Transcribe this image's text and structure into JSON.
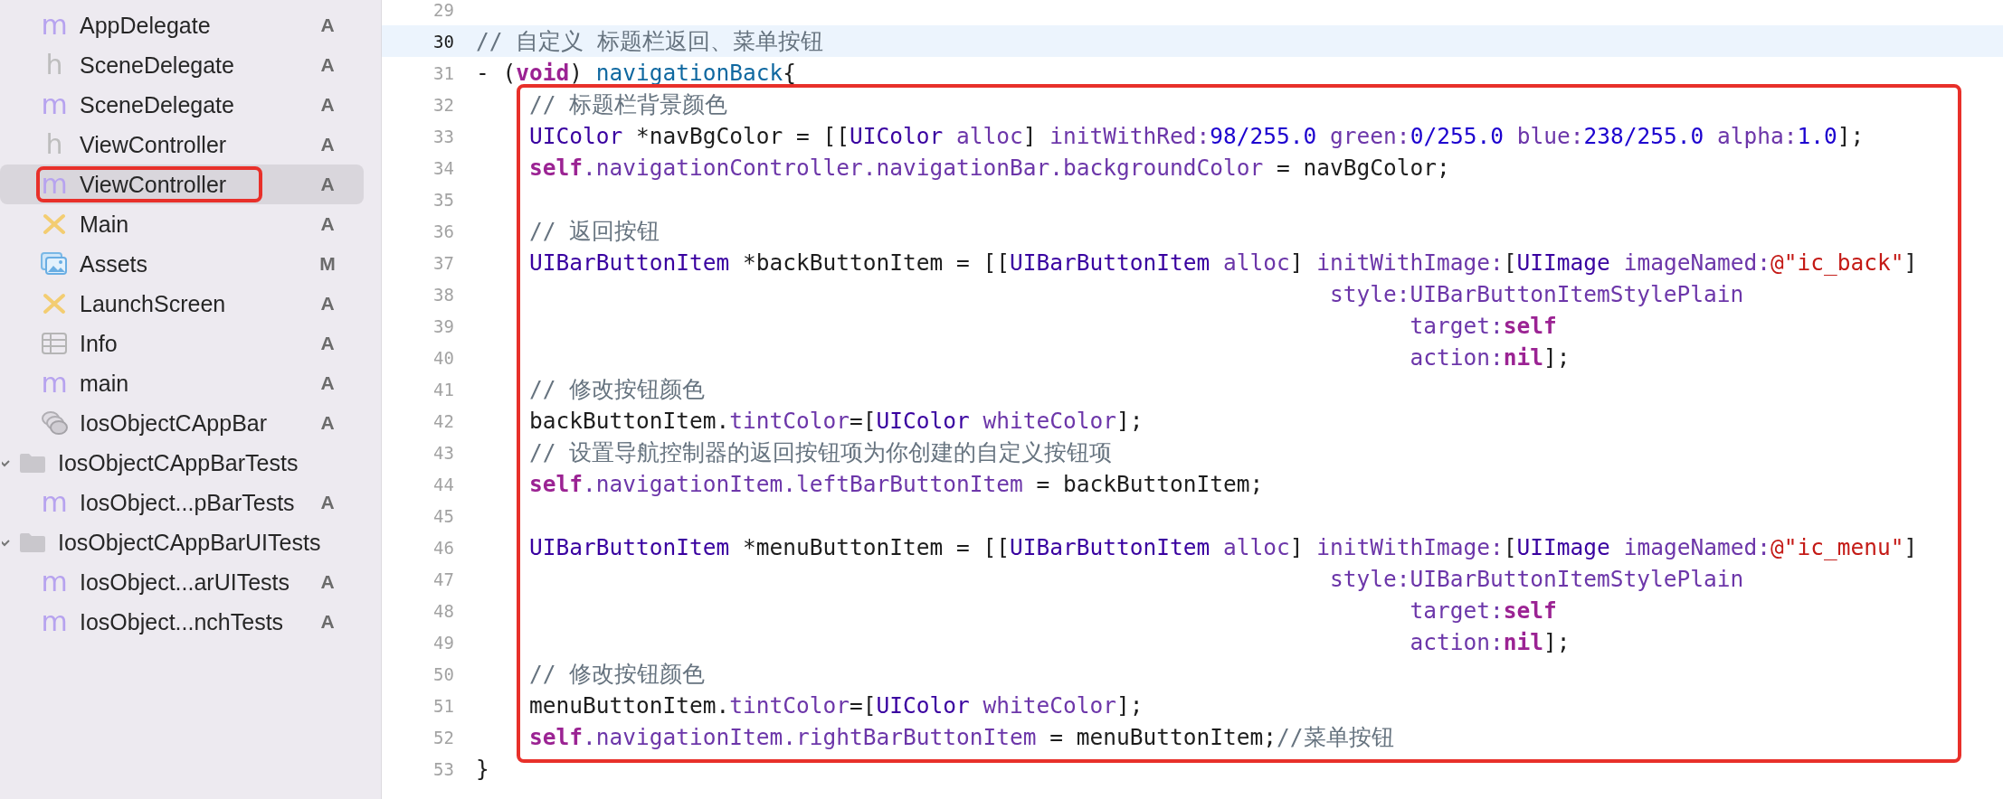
{
  "sidebar": {
    "items": [
      {
        "kind": "source",
        "glyph": "m",
        "name": "AppDelegate",
        "badge": "A",
        "selected": false,
        "outlined": false
      },
      {
        "kind": "header",
        "glyph": "h",
        "name": "SceneDelegate",
        "badge": "A",
        "selected": false,
        "outlined": false
      },
      {
        "kind": "source",
        "glyph": "m",
        "name": "SceneDelegate",
        "badge": "A",
        "selected": false,
        "outlined": false
      },
      {
        "kind": "header",
        "glyph": "h",
        "name": "ViewController",
        "badge": "A",
        "selected": false,
        "outlined": false
      },
      {
        "kind": "source",
        "glyph": "m",
        "name": "ViewController",
        "badge": "A",
        "selected": true,
        "outlined": true
      },
      {
        "kind": "storyboard",
        "name": "Main",
        "badge": "A",
        "selected": false,
        "outlined": false
      },
      {
        "kind": "assets",
        "name": "Assets",
        "badge": "M",
        "selected": false,
        "outlined": false
      },
      {
        "kind": "storyboard",
        "name": "LaunchScreen",
        "badge": "A",
        "selected": false,
        "outlined": false
      },
      {
        "kind": "plist",
        "name": "Info",
        "badge": "A",
        "selected": false,
        "outlined": false
      },
      {
        "kind": "source",
        "glyph": "m",
        "name": "main",
        "badge": "A",
        "selected": false,
        "outlined": false
      },
      {
        "kind": "app",
        "name": "IosObjectCAppBar",
        "badge": "A",
        "selected": false,
        "outlined": false
      },
      {
        "kind": "folder",
        "name": "IosObjectCAppBarTests",
        "expanded": true,
        "selected": false,
        "outlined": false,
        "children": [
          {
            "kind": "source",
            "glyph": "m",
            "name": "IosObject...pBarTests",
            "badge": "A",
            "selected": false,
            "outlined": false
          }
        ]
      },
      {
        "kind": "folder",
        "name": "IosObjectCAppBarUITests",
        "expanded": true,
        "selected": false,
        "outlined": false,
        "children": [
          {
            "kind": "source",
            "glyph": "m",
            "name": "IosObject...arUITests",
            "badge": "A",
            "selected": false,
            "outlined": false
          },
          {
            "kind": "source",
            "glyph": "m",
            "name": "IosObject...nchTests",
            "badge": "A",
            "selected": false,
            "outlined": false
          }
        ]
      }
    ]
  },
  "editor": {
    "sections": [
      {
        "boxed": false,
        "lines": [
          {
            "number": "29",
            "current": false
          },
          {
            "number": "30",
            "current": true,
            "tokens": [
              {
                "kind": "comment",
                "text": "// 自定义 标题栏返回、菜单按钮"
              }
            ]
          },
          {
            "number": "31",
            "current": false,
            "tokens": [
              {
                "kind": "plain",
                "text": "- ("
              },
              {
                "kind": "keyword",
                "text": "void"
              },
              {
                "kind": "plain",
                "text": ") "
              },
              {
                "kind": "decl",
                "text": "navigationBack"
              },
              {
                "kind": "plain",
                "text": "{"
              }
            ]
          }
        ]
      },
      {
        "boxed": true,
        "lines": [
          {
            "number": "32",
            "current": false,
            "tokens": [
              {
                "kind": "comment",
                "text": "    // 标题栏背景颜色"
              }
            ]
          },
          {
            "number": "33",
            "current": false,
            "tokens": [
              {
                "kind": "type",
                "text": "    UIColor"
              },
              {
                "kind": "plain",
                "text": " *navBgColor = [["
              },
              {
                "kind": "type",
                "text": "UIColor"
              },
              {
                "kind": "method",
                "text": " alloc"
              },
              {
                "kind": "plain",
                "text": "] "
              },
              {
                "kind": "method",
                "text": "initWithRed:"
              },
              {
                "kind": "number",
                "text": "98/255.0"
              },
              {
                "kind": "method",
                "text": " green:"
              },
              {
                "kind": "number",
                "text": "0/255.0"
              },
              {
                "kind": "method",
                "text": " blue:"
              },
              {
                "kind": "number",
                "text": "238/255.0"
              },
              {
                "kind": "method",
                "text": " alpha:"
              },
              {
                "kind": "number",
                "text": "1.0"
              },
              {
                "kind": "plain",
                "text": "];"
              }
            ]
          },
          {
            "number": "34",
            "current": false,
            "tokens": [
              {
                "kind": "keyword",
                "text": "    self"
              },
              {
                "kind": "method",
                "text": ".navigationController.navigationBar.backgroundColor"
              },
              {
                "kind": "plain",
                "text": " = navBgColor;"
              }
            ]
          },
          {
            "number": "35",
            "current": false
          },
          {
            "number": "36",
            "current": false,
            "tokens": [
              {
                "kind": "comment",
                "text": "    // 返回按钮"
              }
            ]
          },
          {
            "number": "37",
            "current": false,
            "tokens": [
              {
                "kind": "type",
                "text": "    UIBarButtonItem"
              },
              {
                "kind": "plain",
                "text": " *backButtonItem = [["
              },
              {
                "kind": "type",
                "text": "UIBarButtonItem"
              },
              {
                "kind": "method",
                "text": " alloc"
              },
              {
                "kind": "plain",
                "text": "] "
              },
              {
                "kind": "method",
                "text": "initWithImage:"
              },
              {
                "kind": "plain",
                "text": "["
              },
              {
                "kind": "type",
                "text": "UIImage"
              },
              {
                "kind": "method",
                "text": " imageNamed:"
              },
              {
                "kind": "string",
                "text": "@\"ic_back\""
              },
              {
                "kind": "plain",
                "text": "]"
              }
            ]
          },
          {
            "number": "38",
            "current": false,
            "tokens": [
              {
                "kind": "method",
                "text": "                                                                style:UIBarButtonItemStylePlain"
              }
            ]
          },
          {
            "number": "39",
            "current": false,
            "tokens": [
              {
                "kind": "method",
                "text": "                                                                      target:"
              },
              {
                "kind": "keyword",
                "text": "self"
              }
            ]
          },
          {
            "number": "40",
            "current": false,
            "tokens": [
              {
                "kind": "method",
                "text": "                                                                      action:"
              },
              {
                "kind": "keyword",
                "text": "nil"
              },
              {
                "kind": "plain",
                "text": "];"
              }
            ]
          },
          {
            "number": "41",
            "current": false,
            "tokens": [
              {
                "kind": "comment",
                "text": "    // 修改按钮颜色"
              }
            ]
          },
          {
            "number": "42",
            "current": false,
            "tokens": [
              {
                "kind": "plain",
                "text": "    backButtonItem."
              },
              {
                "kind": "method",
                "text": "tintColor"
              },
              {
                "kind": "plain",
                "text": "=["
              },
              {
                "kind": "type",
                "text": "UIColor"
              },
              {
                "kind": "method",
                "text": " whiteColor"
              },
              {
                "kind": "plain",
                "text": "];"
              }
            ]
          },
          {
            "number": "43",
            "current": false,
            "tokens": [
              {
                "kind": "comment",
                "text": "    // 设置导航控制器的返回按钮项为你创建的自定义按钮项"
              }
            ]
          },
          {
            "number": "44",
            "current": false,
            "tokens": [
              {
                "kind": "keyword",
                "text": "    self"
              },
              {
                "kind": "method",
                "text": ".navigationItem.leftBarButtonItem"
              },
              {
                "kind": "plain",
                "text": " = backButtonItem;"
              }
            ]
          },
          {
            "number": "45",
            "current": false
          },
          {
            "number": "46",
            "current": false,
            "tokens": [
              {
                "kind": "type",
                "text": "    UIBarButtonItem"
              },
              {
                "kind": "plain",
                "text": " *menuButtonItem = [["
              },
              {
                "kind": "type",
                "text": "UIBarButtonItem"
              },
              {
                "kind": "method",
                "text": " alloc"
              },
              {
                "kind": "plain",
                "text": "] "
              },
              {
                "kind": "method",
                "text": "initWithImage:"
              },
              {
                "kind": "plain",
                "text": "["
              },
              {
                "kind": "type",
                "text": "UIImage"
              },
              {
                "kind": "method",
                "text": " imageNamed:"
              },
              {
                "kind": "string",
                "text": "@\"ic_menu\""
              },
              {
                "kind": "plain",
                "text": "]"
              }
            ]
          },
          {
            "number": "47",
            "current": false,
            "tokens": [
              {
                "kind": "method",
                "text": "                                                                style:UIBarButtonItemStylePlain"
              }
            ]
          },
          {
            "number": "48",
            "current": false,
            "tokens": [
              {
                "kind": "method",
                "text": "                                                                      target:"
              },
              {
                "kind": "keyword",
                "text": "self"
              }
            ]
          },
          {
            "number": "49",
            "current": false,
            "tokens": [
              {
                "kind": "method",
                "text": "                                                                      action:"
              },
              {
                "kind": "keyword",
                "text": "nil"
              },
              {
                "kind": "plain",
                "text": "];"
              }
            ]
          },
          {
            "number": "50",
            "current": false,
            "tokens": [
              {
                "kind": "comment",
                "text": "    // 修改按钮颜色"
              }
            ]
          },
          {
            "number": "51",
            "current": false,
            "tokens": [
              {
                "kind": "plain",
                "text": "    menuButtonItem."
              },
              {
                "kind": "method",
                "text": "tintColor"
              },
              {
                "kind": "plain",
                "text": "=["
              },
              {
                "kind": "type",
                "text": "UIColor"
              },
              {
                "kind": "method",
                "text": " whiteColor"
              },
              {
                "kind": "plain",
                "text": "];"
              }
            ]
          },
          {
            "number": "52",
            "current": false,
            "tokens": [
              {
                "kind": "keyword",
                "text": "    self"
              },
              {
                "kind": "method",
                "text": ".navigationItem.rightBarButtonItem"
              },
              {
                "kind": "plain",
                "text": " = menuButtonItem;"
              },
              {
                "kind": "comment",
                "text": "//菜单按钮"
              }
            ]
          }
        ]
      },
      {
        "boxed": false,
        "lines": [
          {
            "number": "53",
            "current": false,
            "tokens": [
              {
                "kind": "plain",
                "text": "}"
              }
            ]
          }
        ]
      }
    ]
  }
}
